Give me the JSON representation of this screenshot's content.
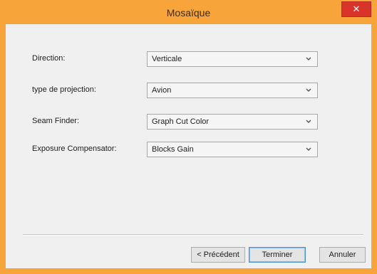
{
  "window": {
    "title": "Mosaïque",
    "close_glyph": "✕",
    "accent_color": "#f7a53a",
    "close_color": "#d9342a"
  },
  "form": {
    "fields": [
      {
        "label": "Direction:",
        "value": "Verticale"
      },
      {
        "label": "type de projection:",
        "value": "Avion"
      },
      {
        "label": "Seam Finder:",
        "value": "Graph Cut Color"
      },
      {
        "label": "Exposure Compensator:",
        "value": "Blocks Gain"
      }
    ]
  },
  "buttons": {
    "previous": "< Précédent",
    "finish": "Terminer",
    "cancel": "Annuler"
  },
  "icons": {
    "close": "close-icon",
    "dropdown": "chevron-down-icon"
  }
}
